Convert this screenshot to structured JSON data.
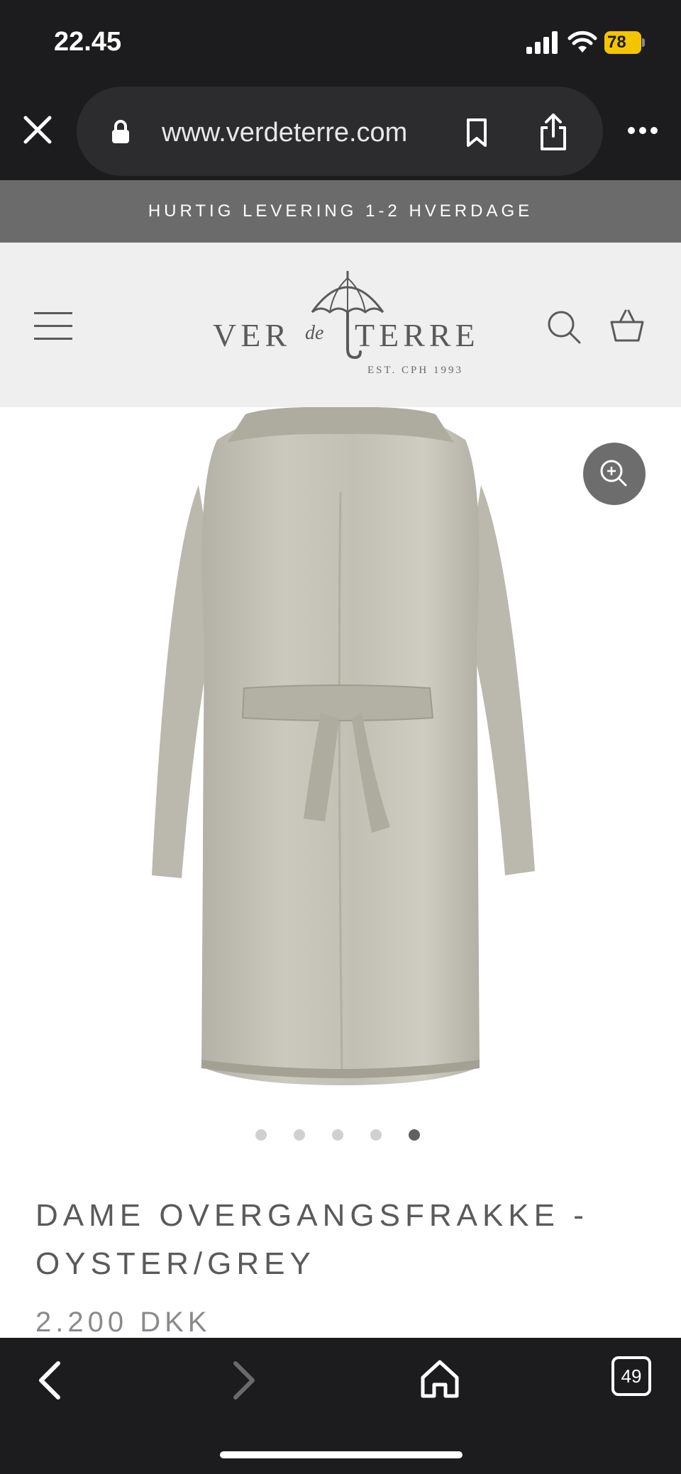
{
  "status_bar": {
    "time": "22.45",
    "battery": "78"
  },
  "browser": {
    "url": "www.verdeterre.com",
    "tab_count": "49"
  },
  "announcement": {
    "text": "HURTIG LEVERING 1-2 HVERDAGE"
  },
  "header": {
    "logo_left": "VER",
    "logo_de": "de",
    "logo_right": "TERRE",
    "logo_est": "EST. CPH 1993"
  },
  "gallery": {
    "slide_count": 5,
    "active_slide": 5
  },
  "product": {
    "title": "DAME OVERGANGSFRAKKE - OYSTER/GREY",
    "price": "2.200 DKK"
  },
  "colors": {
    "chrome": "#1c1c1e",
    "announcement_bg": "#6b6b6b",
    "header_bg": "#efefef",
    "battery": "#f5c400",
    "coat": "#c4c1b6"
  },
  "icons": {
    "close": "close-icon",
    "lock": "lock-icon",
    "bookmark": "bookmark-icon",
    "share": "share-icon",
    "more": "more-icon",
    "menu": "hamburger-icon",
    "search": "search-icon",
    "basket": "basket-icon",
    "zoom": "zoom-in-icon",
    "back": "chevron-left-icon",
    "forward": "chevron-right-icon",
    "home": "home-icon"
  }
}
